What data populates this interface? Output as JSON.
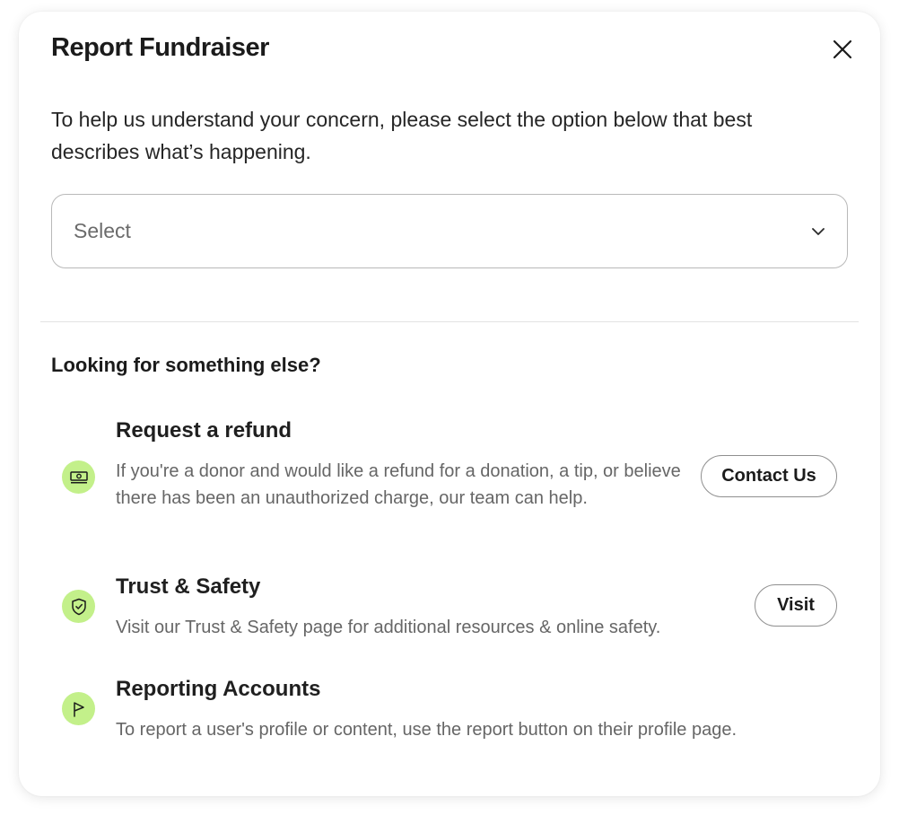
{
  "modal": {
    "title": "Report Fundraiser",
    "intro": "To help us understand your concern, please select the option below that best describes what’s happening."
  },
  "select": {
    "value": "Select"
  },
  "help": {
    "heading": "Looking for something else?",
    "items": [
      {
        "icon": "money-icon",
        "title": "Request a refund",
        "description": "If you're a donor and would like a refund for a donation, a tip, or believe there has been an unauthorized charge, our team can help.",
        "button": "Contact Us"
      },
      {
        "icon": "shield-check-icon",
        "title": "Trust & Safety",
        "description": "Visit our Trust & Safety page for additional resources & online safety.",
        "button": "Visit"
      },
      {
        "icon": "flag-icon",
        "title": "Reporting Accounts",
        "description": "To report a user's profile or content, use the report button on their profile page."
      }
    ]
  },
  "colors": {
    "icon_background": "#c3f08a",
    "text_primary": "#1f1f1f",
    "text_secondary": "#666666",
    "border": "#b9b9b9"
  }
}
